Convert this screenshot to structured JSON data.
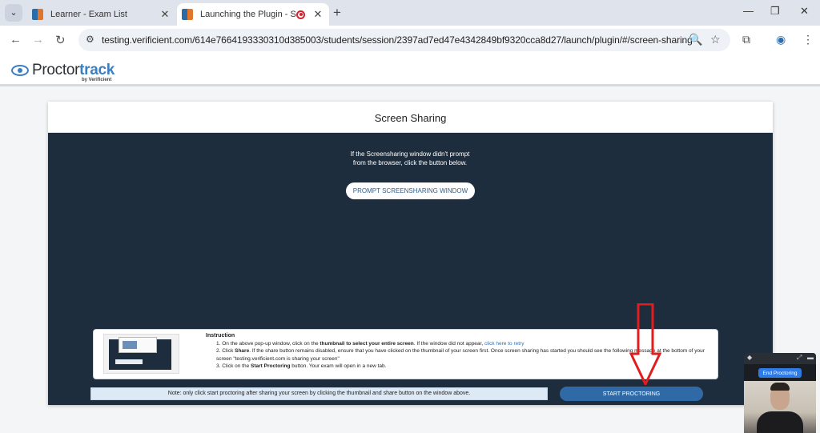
{
  "browser": {
    "tabs": [
      {
        "title": "Learner - Exam List",
        "active": false
      },
      {
        "title": "Launching the Plugin - Start",
        "active": true,
        "recording": true
      }
    ],
    "url": "testing.verificient.com/614e7664193330310d385003/students/session/2397ad7ed47e4342849bf9320cca8d27/launch/plugin/#/screen-sharing",
    "icons": {
      "tab_menu": "⌄",
      "close": "✕",
      "new_tab": "+",
      "minimize": "—",
      "restore": "❐",
      "window_close": "✕",
      "back": "←",
      "forward": "→",
      "reload": "↻",
      "site_info": "⚙",
      "zoom": "🔍",
      "bookmark": "☆",
      "extensions": "⧉",
      "profile": "◉",
      "menu": "⋮"
    }
  },
  "brand": {
    "name_prefix": "Proctor",
    "name_accent": "track",
    "subtitle": "by Verificient",
    "accent_color": "#3a7fc1"
  },
  "panel": {
    "title": "Screen Sharing",
    "prompt_line1": "If the Screensharing window didn't prompt",
    "prompt_line2": "from the browser, click the button below.",
    "prompt_button": "PROMPT SCREENSHARING WINDOW",
    "background_color": "#1e2d3d"
  },
  "instructions": {
    "title": "Instruction",
    "step1_num": "1.",
    "step1_a": "On the above pop-up window, click on the ",
    "step1_b": "thumbnail to select your entire screen",
    "step1_c": ". If the window did not appear, ",
    "step1_link": "click here to retry",
    "step2_num": "2.",
    "step2_a": "Click ",
    "step2_b": "Share",
    "step2_c": ". If the share button remains disabled, ensure that you have clicked on the thumbnail of your screen first. Once screen sharing has started you should see the following message at the bottom of your screen \"testing.verificient.com is sharing your screen\"",
    "step3_num": "3.",
    "step3_a": "Click on the ",
    "step3_b": "Start Proctoring",
    "step3_c": " button. Your exam will open in a new tab."
  },
  "footer": {
    "note": "Note: only click start proctoring after sharing your screen by clicking the thumbnail and share button on the window above.",
    "start_button": "START PROCTORING"
  },
  "webcam": {
    "end_button": "End Proctoring",
    "icons": {
      "settings": "◆",
      "expand": "⤢",
      "close": "▬"
    }
  },
  "annotation": {
    "arrow_color": "#e11d1d"
  }
}
